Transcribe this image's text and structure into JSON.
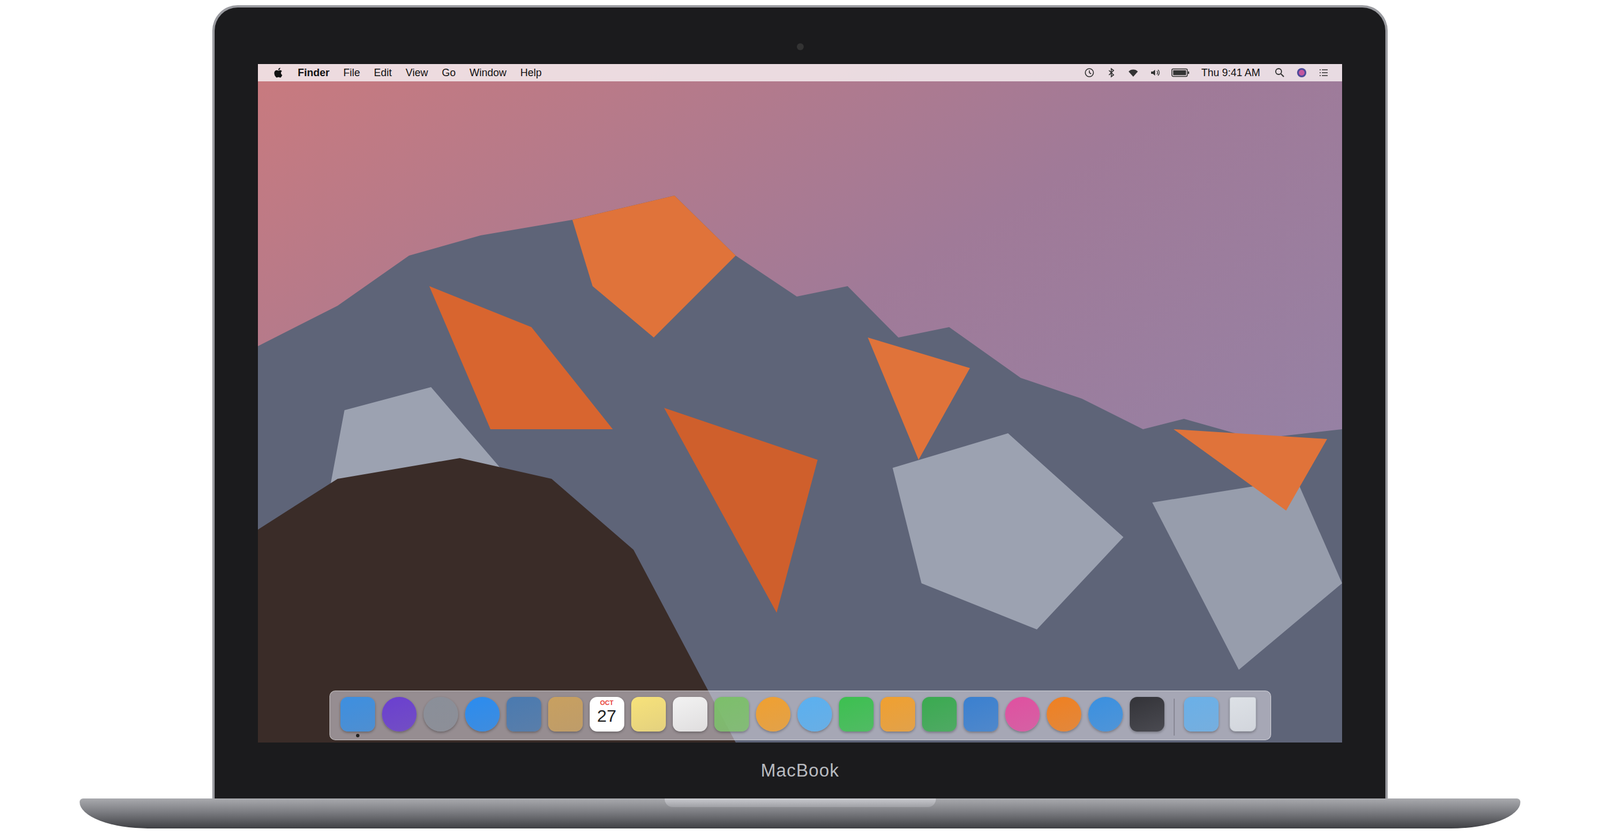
{
  "menu_bar": {
    "app": "Finder",
    "menus": [
      "File",
      "Edit",
      "View",
      "Go",
      "Window",
      "Help"
    ],
    "clock": "Thu 9:41 AM"
  },
  "dock": {
    "apps": [
      {
        "kind": "square",
        "color": "#3d8fe0",
        "running": true
      },
      {
        "kind": "round",
        "color": "#6a3fd0",
        "running": false
      },
      {
        "kind": "round",
        "color": "#8a8f99",
        "running": false
      },
      {
        "kind": "round",
        "color": "#2a8cf0",
        "running": false
      },
      {
        "kind": "square",
        "color": "#4a7ab0",
        "running": false
      },
      {
        "kind": "square",
        "color": "#c8a060",
        "running": false
      },
      {
        "kind": "calendar",
        "color": "#e8453c",
        "running": false,
        "month": "OCT",
        "day": "27"
      },
      {
        "kind": "square",
        "color": "#f7e27a",
        "running": false
      },
      {
        "kind": "square",
        "color": "#f2f2f2",
        "running": false
      },
      {
        "kind": "square",
        "color": "#7cbf6a",
        "running": false
      },
      {
        "kind": "round",
        "color": "#f0a030",
        "running": false
      },
      {
        "kind": "round",
        "color": "#5ab0f0",
        "running": false
      },
      {
        "kind": "square",
        "color": "#3cc050",
        "running": false
      },
      {
        "kind": "square",
        "color": "#f0a030",
        "running": false
      },
      {
        "kind": "square",
        "color": "#3aaa50",
        "running": false
      },
      {
        "kind": "square",
        "color": "#3a80d0",
        "running": false
      },
      {
        "kind": "round",
        "color": "#e050a0",
        "running": false
      },
      {
        "kind": "round",
        "color": "#f08020",
        "running": false
      },
      {
        "kind": "round",
        "color": "#3a90e0",
        "running": false
      },
      {
        "kind": "square",
        "color": "#333338",
        "running": false
      }
    ],
    "stacks": [
      {
        "kind": "square",
        "color": "#6ab0e8",
        "running": false
      },
      {
        "kind": "trash",
        "color": "#dde1e6",
        "running": false
      }
    ]
  },
  "device": {
    "label": "MacBook"
  }
}
